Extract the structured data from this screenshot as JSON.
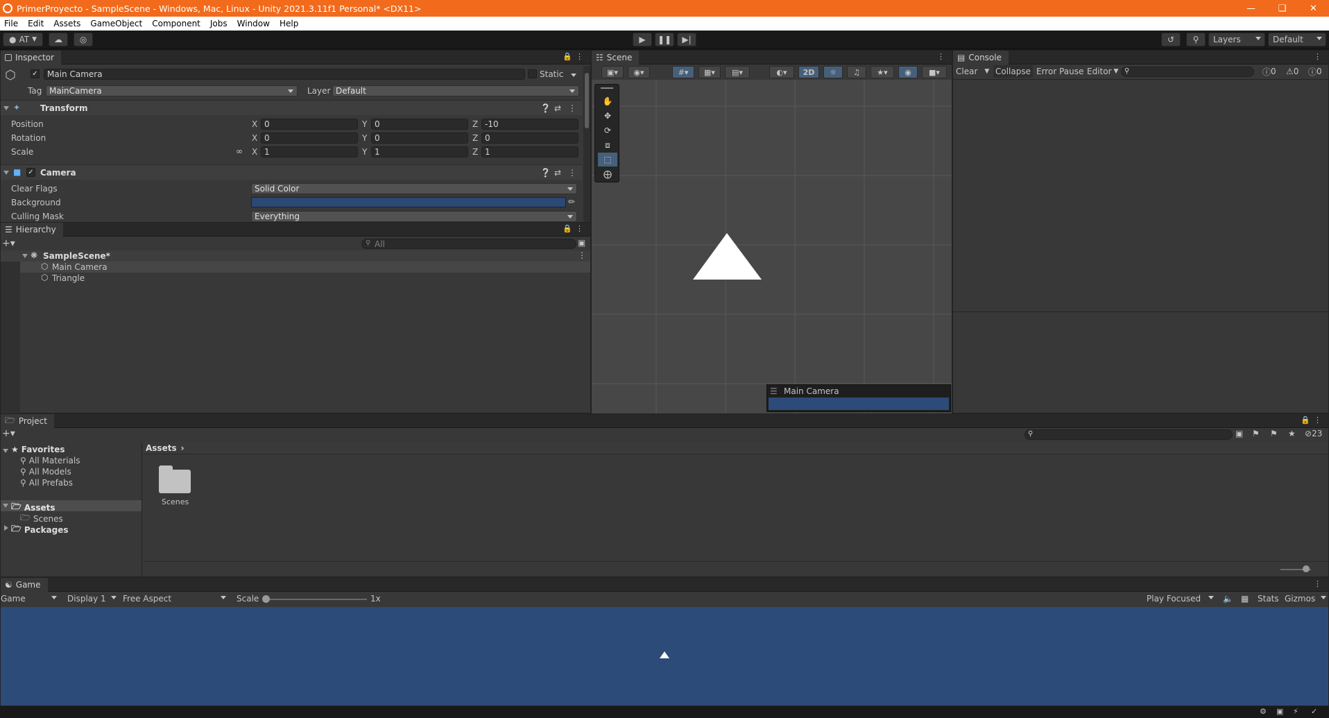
{
  "window": {
    "title": "PrimerProyecto - SampleScene - Windows, Mac, Linux - Unity 2021.3.11f1 Personal* <DX11>"
  },
  "menu": [
    "File",
    "Edit",
    "Assets",
    "GameObject",
    "Component",
    "Jobs",
    "Window",
    "Help"
  ],
  "toolbar": {
    "account": "AT",
    "layers": "Layers",
    "layout": "Default"
  },
  "inspector": {
    "tab": "Inspector",
    "object_name": "Main Camera",
    "static_label": "Static",
    "tag_label": "Tag",
    "tag_value": "MainCamera",
    "layer_label": "Layer",
    "layer_value": "Default",
    "transform": {
      "title": "Transform",
      "position_label": "Position",
      "rotation_label": "Rotation",
      "scale_label": "Scale",
      "position": {
        "x": "0",
        "y": "0",
        "z": "-10"
      },
      "rotation": {
        "x": "0",
        "y": "0",
        "z": "0"
      },
      "scale": {
        "x": "1",
        "y": "1",
        "z": "1"
      },
      "axis_x": "X",
      "axis_y": "Y",
      "axis_z": "Z"
    },
    "camera": {
      "title": "Camera",
      "clear_flags_label": "Clear Flags",
      "clear_flags_value": "Solid Color",
      "background_label": "Background",
      "background_color": "#2c4875",
      "culling_label": "Culling Mask",
      "culling_value": "Everything"
    }
  },
  "hierarchy": {
    "tab": "Hierarchy",
    "search_placeholder": "All",
    "scene": "SampleScene*",
    "items": [
      "Main Camera",
      "Triangle"
    ]
  },
  "scene": {
    "tab": "Scene",
    "mode_2d": "2D",
    "camera_overlay_title": "Main Camera",
    "bg_color": "#474747",
    "grid_color": "#5a5a5a"
  },
  "console": {
    "tab": "Console",
    "clear": "Clear",
    "collapse": "Collapse",
    "error_pause": "Error Pause",
    "editor": "Editor",
    "log_count": "0",
    "warn_count": "0",
    "error_count": "0"
  },
  "project": {
    "tab": "Project",
    "favorites": "Favorites",
    "favorite_items": [
      "All Materials",
      "All Models",
      "All Prefabs"
    ],
    "assets": "Assets",
    "asset_children": [
      "Scenes"
    ],
    "packages": "Packages",
    "breadcrumb": "Assets",
    "folders": [
      "Scenes"
    ],
    "hidden_count": "23"
  },
  "game": {
    "tab": "Game",
    "mode": "Game",
    "display": "Display 1",
    "aspect": "Free Aspect",
    "scale_label": "Scale",
    "scale_value": "1x",
    "play_focused": "Play Focused",
    "stats": "Stats",
    "gizmos": "Gizmos",
    "bg_color": "#2d4b78"
  }
}
